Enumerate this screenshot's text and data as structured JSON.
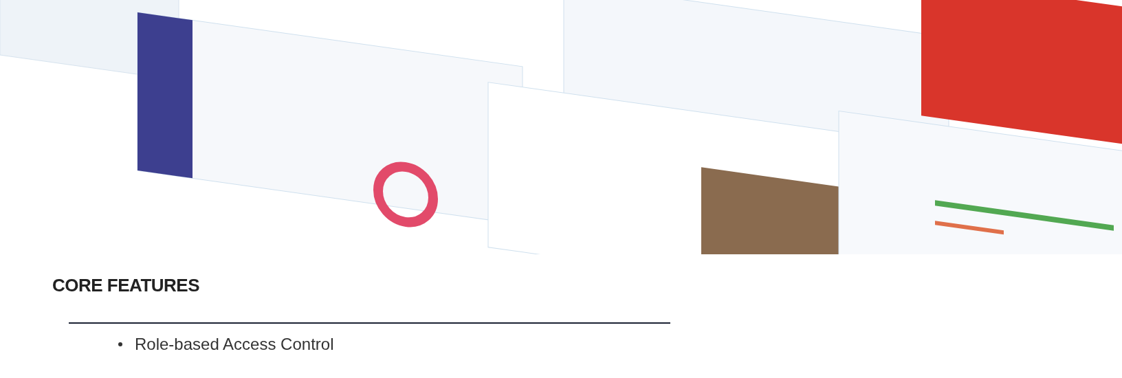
{
  "section": {
    "heading": "CORE FEATURES",
    "features": [
      {
        "text": "Role-based Access Control"
      }
    ]
  }
}
